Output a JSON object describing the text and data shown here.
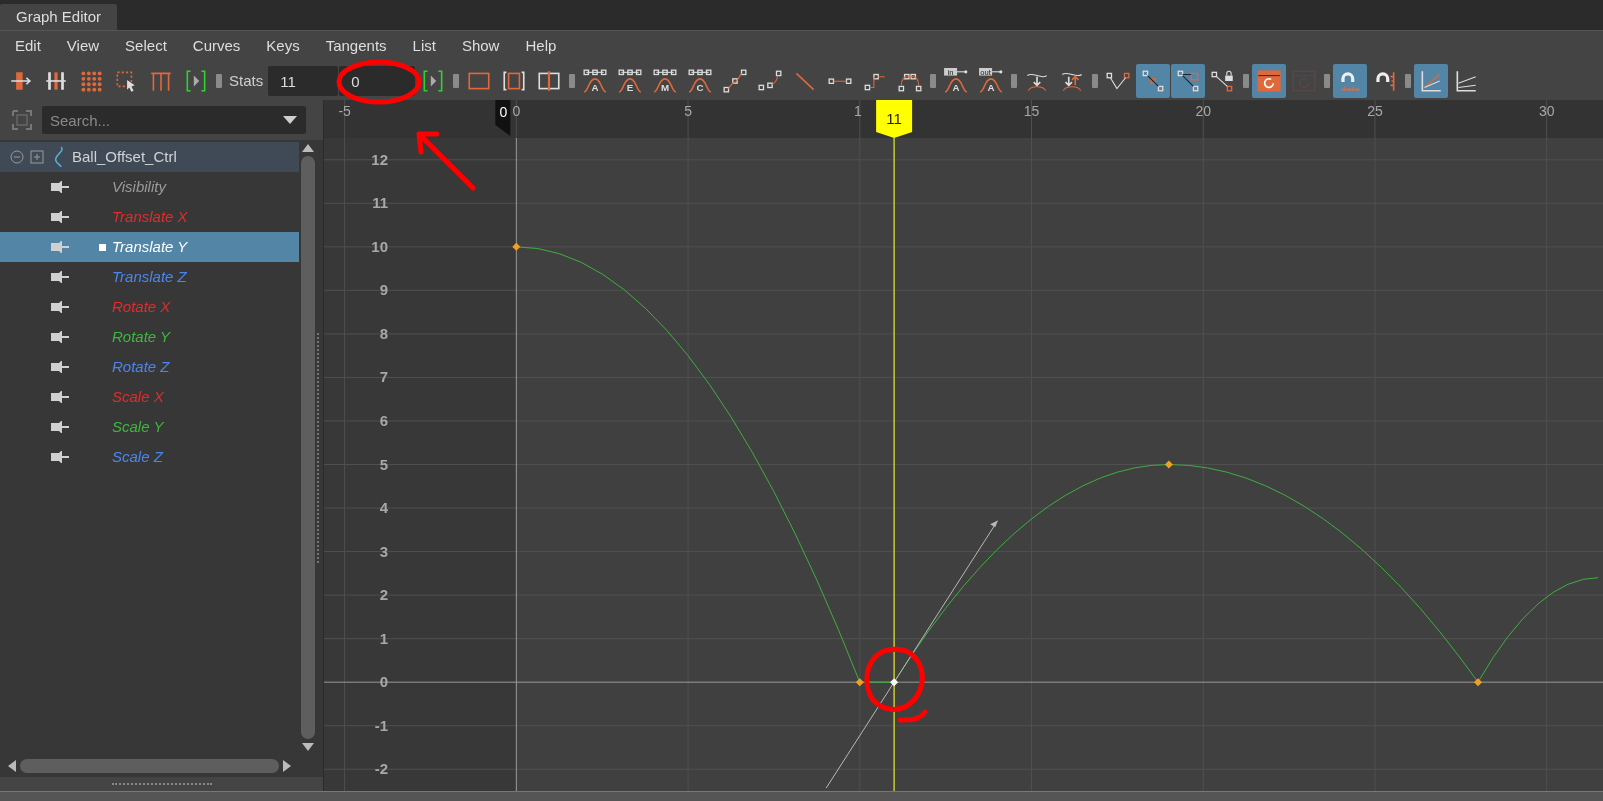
{
  "window": {
    "title": "Graph Editor"
  },
  "menu": [
    "Edit",
    "View",
    "Select",
    "Curves",
    "Keys",
    "Tangents",
    "List",
    "Show",
    "Help"
  ],
  "toolbar": [
    {
      "kind": "move-key",
      "selected": false
    },
    {
      "kind": "insert-key",
      "selected": false
    },
    {
      "kind": "lattice",
      "selected": false
    },
    {
      "kind": "region",
      "selected": false
    },
    {
      "kind": "retime",
      "selected": false
    },
    {
      "kind": "bracket",
      "selected": false
    },
    {
      "kind": "sep"
    },
    {
      "kind": "label",
      "text": "Stats"
    },
    {
      "kind": "field",
      "value": "11"
    },
    {
      "kind": "field",
      "value": "0"
    },
    {
      "kind": "bracket",
      "selected": false
    },
    {
      "kind": "sep"
    },
    {
      "kind": "frame-all",
      "selected": false
    },
    {
      "kind": "frame-playback",
      "selected": false
    },
    {
      "kind": "center",
      "selected": false
    },
    {
      "kind": "sep"
    },
    {
      "kind": "curve-glyph",
      "glyph": "A",
      "selected": false
    },
    {
      "kind": "curve-glyph",
      "glyph": "E",
      "selected": false
    },
    {
      "kind": "curve-glyph",
      "glyph": "M",
      "selected": false
    },
    {
      "kind": "curve-glyph",
      "glyph": "C",
      "selected": false
    },
    {
      "kind": "spline",
      "selected": false
    },
    {
      "kind": "clamped",
      "selected": false
    },
    {
      "kind": "linear",
      "selected": false
    },
    {
      "kind": "flat",
      "selected": false
    },
    {
      "kind": "step",
      "selected": false
    },
    {
      "kind": "plateau",
      "selected": false
    },
    {
      "kind": "sep"
    },
    {
      "kind": "tagged-curve",
      "tag": "in",
      "glyph": "A",
      "selected": false
    },
    {
      "kind": "tagged-curve",
      "tag": "out",
      "glyph": "A",
      "selected": false
    },
    {
      "kind": "sep"
    },
    {
      "kind": "buffer-down",
      "selected": false
    },
    {
      "kind": "buffer-swap",
      "selected": false
    },
    {
      "kind": "sep"
    },
    {
      "kind": "break",
      "selected": false
    },
    {
      "kind": "unify",
      "selected": true
    },
    {
      "kind": "weighted",
      "selected": true
    },
    {
      "kind": "lock",
      "selected": false
    },
    {
      "kind": "sep"
    },
    {
      "kind": "refresh",
      "selected": true
    },
    {
      "kind": "refresh-dim",
      "selected": false,
      "disabled": true
    },
    {
      "kind": "sep"
    },
    {
      "kind": "magnet-ruler",
      "selected": true
    },
    {
      "kind": "magnet",
      "selected": false
    },
    {
      "kind": "sep"
    },
    {
      "kind": "graph",
      "selected": true
    },
    {
      "kind": "graph-lines",
      "selected": false
    }
  ],
  "search": {
    "placeholder": "Search..."
  },
  "outliner": {
    "root": {
      "label": "Ball_Offset_Ctrl",
      "expanded": true,
      "children": [
        {
          "label": "Visibility",
          "color": "#9a9a9a",
          "selected": false
        },
        {
          "label": "Translate X",
          "color": "#e52a2a",
          "selected": false
        },
        {
          "label": "Translate Y",
          "color": "#ffffff",
          "selected": true
        },
        {
          "label": "Translate Z",
          "color": "#4a86ef",
          "selected": false
        },
        {
          "label": "Rotate X",
          "color": "#e52a2a",
          "selected": false
        },
        {
          "label": "Rotate Y",
          "color": "#3db83d",
          "selected": false
        },
        {
          "label": "Rotate Z",
          "color": "#4a86ef",
          "selected": false
        },
        {
          "label": "Scale X",
          "color": "#e52a2a",
          "selected": false
        },
        {
          "label": "Scale Y",
          "color": "#3db83d",
          "selected": false
        },
        {
          "label": "Scale Z",
          "color": "#4a86ef",
          "selected": false
        }
      ]
    }
  },
  "graph": {
    "chart_data": {
      "type": "line",
      "x": [
        0,
        10,
        11,
        19,
        28,
        31.5
      ],
      "series": [
        {
          "color": "#3fae3f",
          "marker": "diamond",
          "values": [
            10,
            0,
            0,
            5,
            0,
            2.4
          ]
        }
      ],
      "xlim": [
        -5.6,
        31.64
      ],
      "ylim": [
        -2.5,
        12.5
      ],
      "grid": true,
      "xticks": [
        -5,
        0,
        5,
        15,
        20,
        25,
        30
      ],
      "yticks": [
        -2,
        -1,
        0,
        1,
        2,
        3,
        4,
        5,
        6,
        7,
        8,
        9,
        10,
        11,
        12
      ],
      "ref_lines": [
        {
          "axis": "x",
          "value": 11
        }
      ],
      "bands": [
        {
          "axis": "x",
          "from": -5.6,
          "to": 0
        }
      ]
    },
    "ruler_fragment": "1",
    "time_markers": [
      {
        "kind": "start",
        "text": "0"
      },
      {
        "kind": "current",
        "text": "11"
      }
    ],
    "keys": [
      {
        "selected": false
      },
      {
        "selected": false
      },
      {
        "selected": true
      },
      {
        "selected": false
      },
      {
        "selected": false
      }
    ]
  }
}
